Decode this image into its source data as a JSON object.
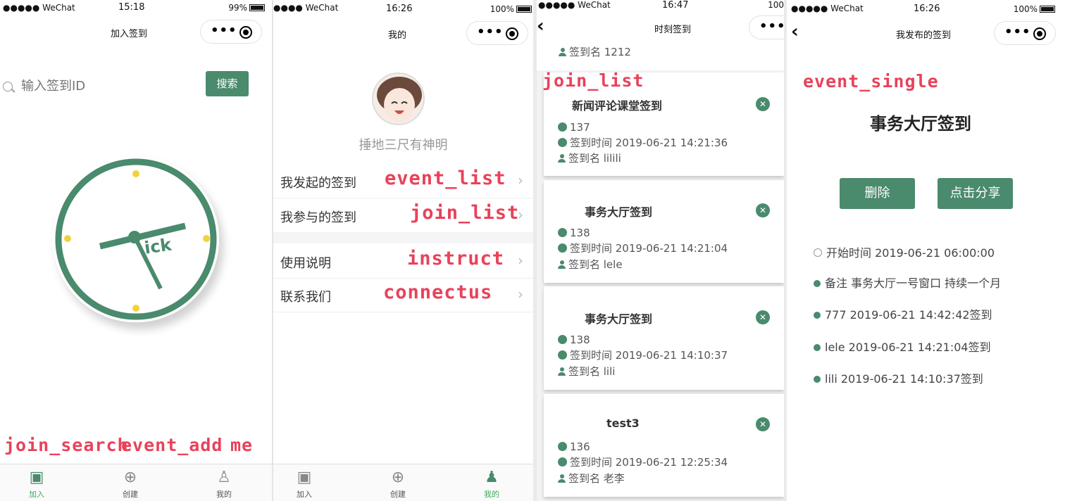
{
  "p1": {
    "status": {
      "carrier": "●●●●● WeChat",
      "time": "15:18",
      "battery": "99%"
    },
    "title": "加入签到",
    "search": {
      "placeholder": "输入签到ID",
      "button": "搜索"
    },
    "clock_text": "ick",
    "labels": [
      "join_search",
      "event_add",
      "me"
    ],
    "tabs": [
      {
        "label": "加入"
      },
      {
        "label": "创建"
      },
      {
        "label": "我的"
      }
    ]
  },
  "p2": {
    "status": {
      "carrier": "●●●● WeChat",
      "time": "16:26",
      "battery": "100%"
    },
    "title": "我的",
    "username": "捶地三尺有神明",
    "menu": [
      {
        "label": "我发起的签到",
        "tag": "event_list"
      },
      {
        "label": "我参与的签到",
        "tag": "join_list"
      },
      {
        "label": "使用说明",
        "tag": "instruct"
      },
      {
        "label": "联系我们",
        "tag": "connectus"
      }
    ],
    "tabs": [
      {
        "label": "加入"
      },
      {
        "label": "创建"
      },
      {
        "label": "我的"
      }
    ]
  },
  "p3": {
    "status": {
      "carrier": "●●●●● WeChat",
      "time": "16:47",
      "battery": "100"
    },
    "title": "时刻签到",
    "label": "join_list",
    "top_row": "签到名 1212",
    "cards": [
      {
        "title": "新闻评论课堂签到",
        "id": "137",
        "time": "签到时间 2019-06-21 14:21:36",
        "name": "签到名 lilili"
      },
      {
        "title": "事务大厅签到",
        "id": "138",
        "time": "签到时间 2019-06-21 14:21:04",
        "name": "签到名 lele"
      },
      {
        "title": "事务大厅签到",
        "id": "138",
        "time": "签到时间 2019-06-21 14:10:37",
        "name": "签到名 lili"
      },
      {
        "title": "test3",
        "id": "136",
        "time": "签到时间 2019-06-21 12:25:34",
        "name": "签到名 老李"
      }
    ]
  },
  "p4": {
    "status": {
      "carrier": "●●●●● WeChat",
      "time": "16:26",
      "battery": "100%"
    },
    "title": "我发布的签到",
    "label": "event_single",
    "event_title": "事务大厅签到",
    "buttons": {
      "delete": "删除",
      "share": "点击分享"
    },
    "start": "开始时间 2019-06-21 06:00:00",
    "note": "备注 事务大厅一号窗口 持续一个月",
    "records": [
      "777 2019-06-21 14:42:42签到",
      "lele 2019-06-21 14:21:04签到",
      "lili 2019-06-21 14:10:37签到"
    ]
  },
  "colors": {
    "primary": "#4a8a6d",
    "annotation": "#e8425a",
    "clock_dot": "#f2d23b"
  }
}
